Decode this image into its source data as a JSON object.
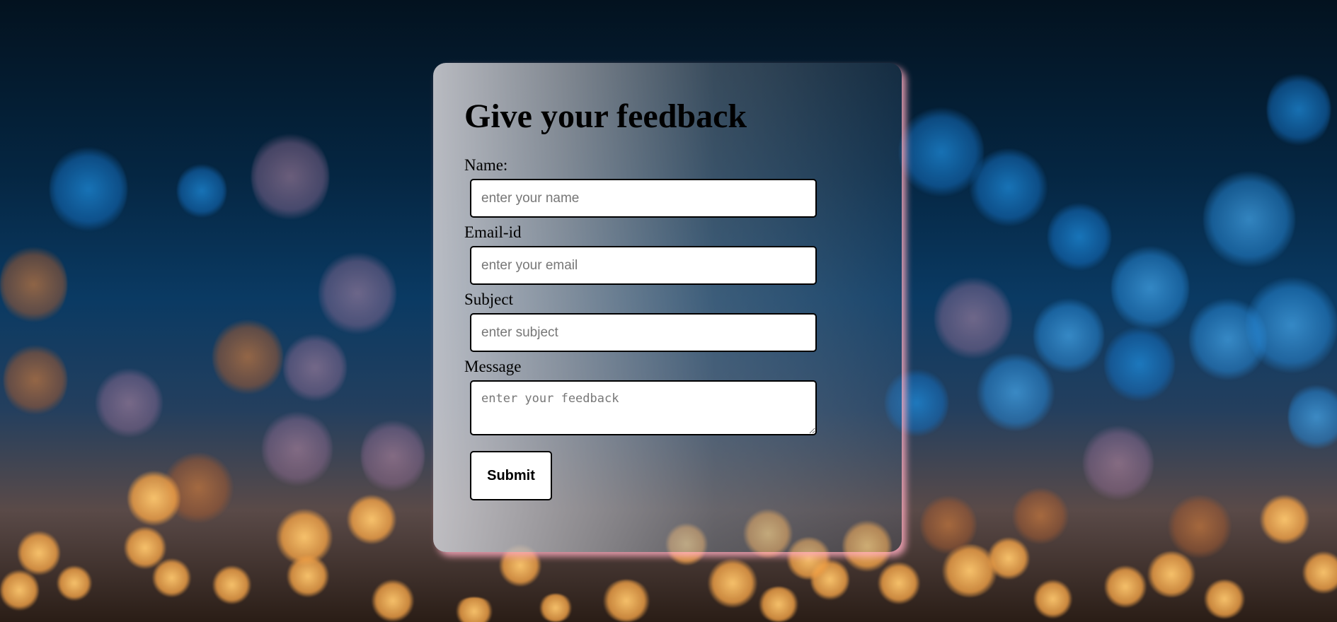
{
  "form": {
    "title": "Give your feedback",
    "name_label": "Name:",
    "name_placeholder": "enter your name",
    "email_label": "Email-id",
    "email_placeholder": "enter your email",
    "subject_label": "Subject",
    "subject_placeholder": "enter subject",
    "message_label": "Message",
    "message_placeholder": "enter your feedback",
    "submit_label": "Submit"
  },
  "colors": {
    "card_shadow": "#ffaabe",
    "field_border": "#000000",
    "field_background": "#ffffff"
  }
}
